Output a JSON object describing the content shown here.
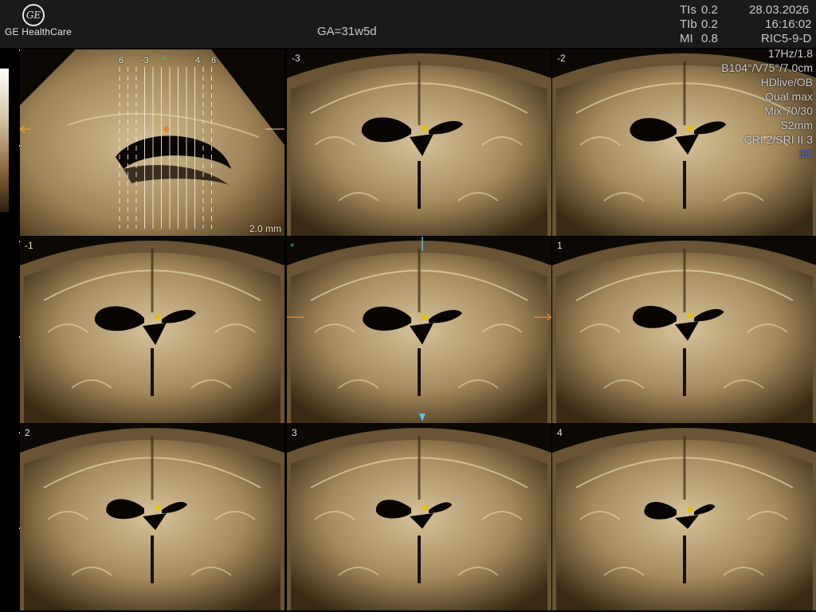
{
  "header": {
    "brand": "GE HealthCare",
    "logo_text": "GE",
    "ga": "GA=31w5d",
    "tis_label": "TIs",
    "tis_value": "0.2",
    "tib_label": "TIb",
    "tib_value": "0.2",
    "mi_label": "MI",
    "mi_value": "0.8",
    "date": "28.03.2026",
    "time": "16:16:02",
    "probe": "RIC5-9-D"
  },
  "info_panel": [
    "17Hz/1.8",
    "B104°/V75°/7.0cm",
    "HDlive/OB",
    "Qual max",
    "Mix 70/30",
    "S2mm",
    "CRI 2/SRI II 3"
  ],
  "mode": "3D",
  "reference": {
    "top_labels": [
      "6",
      "-3",
      "4",
      "6"
    ],
    "slice_spacing": "2.0 mm"
  },
  "slices": [
    "-3",
    "-2",
    "-1",
    "",
    "1",
    "2",
    "3",
    "4"
  ],
  "colors": {
    "tissue": "#b9a27a",
    "marker": "#e6c200",
    "accent_blue": "#4c6cff",
    "ref_orange": "#d8893a",
    "ref_cyan": "#5fc0d8"
  }
}
